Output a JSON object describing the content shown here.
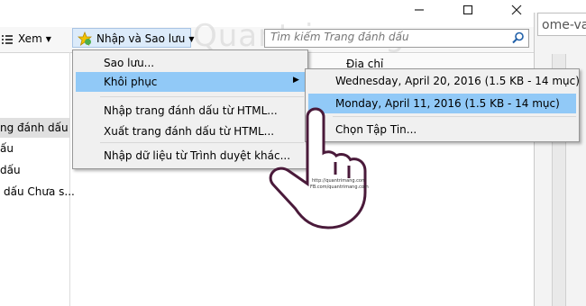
{
  "window": {
    "controls": [
      "minimize-icon",
      "maximize-icon",
      "close-icon"
    ]
  },
  "browser": {
    "url_text": "ome-va"
  },
  "toolbar": {
    "view_label": "Xem",
    "import_backup_label": "Nhập và Sao lưu",
    "search_placeholder": "Tìm kiếm Trang đánh dấu"
  },
  "tree": {
    "items": [
      "ng đánh dấu",
      "ấu",
      "dấu",
      "dấu Chưa s..."
    ],
    "selected_index": 0
  },
  "list": {
    "column_header": "Địa chỉ"
  },
  "import_menu": {
    "items": [
      {
        "label": "Sao lưu...",
        "highlighted": false
      },
      {
        "label": "Khôi phục",
        "highlighted": true,
        "has_submenu": true
      },
      {
        "label": "Nhập trang đánh dấu từ HTML...",
        "highlighted": false
      },
      {
        "label": "Xuất trang đánh dấu từ HTML...",
        "highlighted": false
      },
      {
        "label": "Nhập dữ liệu từ Trình duyệt khác...",
        "highlighted": false
      }
    ]
  },
  "restore_submenu": {
    "items": [
      {
        "label": "Wednesday, April 20, 2016 (1.5 KB - 14 mục)",
        "highlighted": false
      },
      {
        "label": "Monday, April 11, 2016 (1.5 KB - 14 mục)",
        "highlighted": true
      },
      {
        "label": "Chọn Tập Tin...",
        "highlighted": false
      }
    ]
  },
  "watermark": {
    "text": "Quantrimang",
    "cursor_caption_1": "http://quantrimang.com",
    "cursor_caption_2": "FB.com/quantrimang.com"
  },
  "colors": {
    "highlight": "#91c9f7",
    "menu_bg": "#f0f0f0"
  }
}
